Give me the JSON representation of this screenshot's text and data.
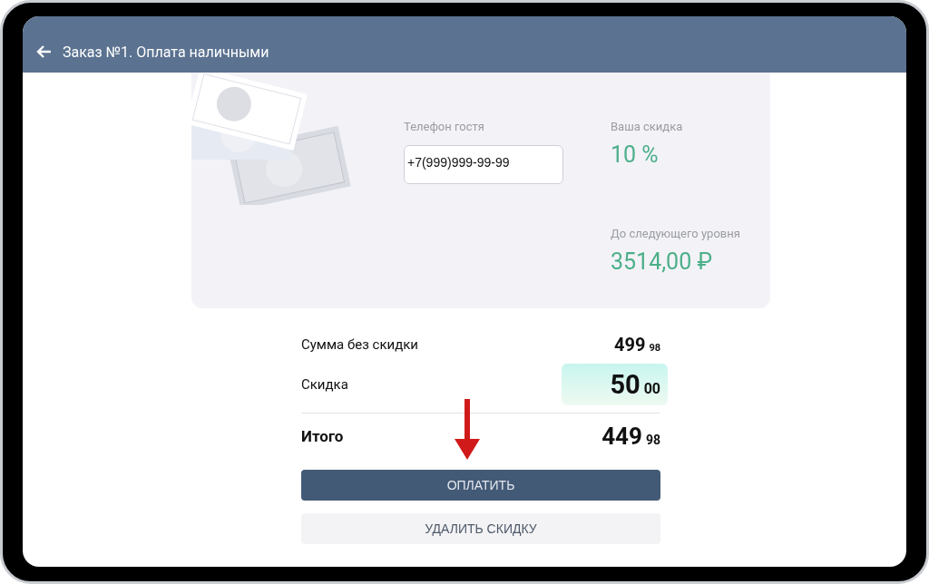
{
  "header": {
    "title": "Заказ №1. Оплата наличными"
  },
  "guest_phone": {
    "label": "Телефон гостя",
    "value": "+7(999)999-99-99"
  },
  "discount": {
    "label": "Ваша скидка",
    "value": "10 %"
  },
  "next_level": {
    "label": "До следующего уровня",
    "value": "3514,00 ₽"
  },
  "summary": [
    {
      "kind": "plain",
      "label": "Сумма без скидки",
      "amount": "499",
      "cents": "98"
    },
    {
      "kind": "highlight",
      "label": "Скидка",
      "amount": "50",
      "cents": "00"
    },
    {
      "kind": "total",
      "label": "Итого",
      "amount": "449",
      "cents": "98"
    }
  ],
  "buttons": [
    {
      "kind": "primary",
      "label": "ОПЛАТИТЬ"
    },
    {
      "kind": "secondary",
      "label": "УДАЛИТЬ СКИДКУ"
    }
  ]
}
